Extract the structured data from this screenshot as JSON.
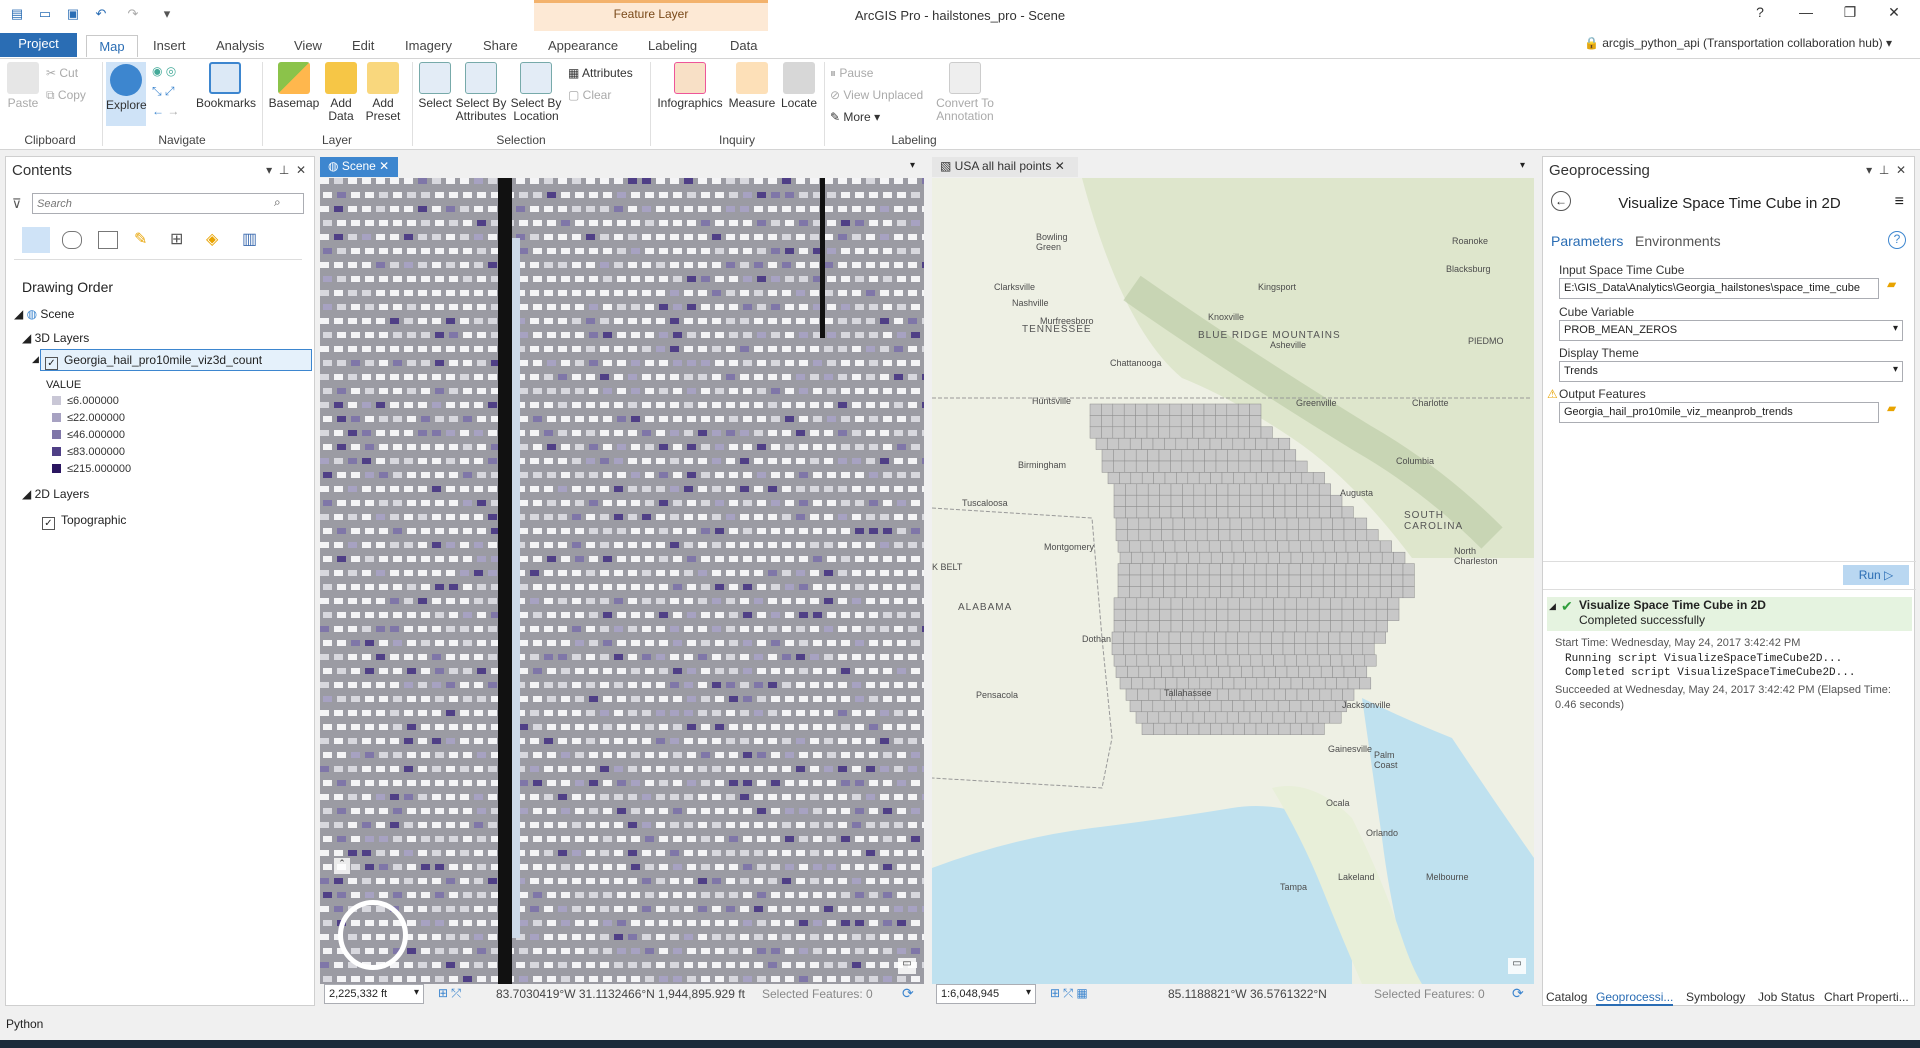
{
  "app": {
    "window_title": "ArcGIS Pro - hailstones_pro - Scene",
    "contextual_group": "Feature Layer",
    "user": "arcgis_python_api (Transportation collaboration hub)",
    "help": "?"
  },
  "tabs": [
    "Project",
    "Map",
    "Insert",
    "Analysis",
    "View",
    "Edit",
    "Imagery",
    "Share",
    "Appearance",
    "Labeling",
    "Data"
  ],
  "ribbon": {
    "clipboard": {
      "label": "Clipboard",
      "paste": "Paste",
      "cut": "Cut",
      "copy": "Copy"
    },
    "navigate": {
      "label": "Navigate",
      "explore": "Explore",
      "bookmarks": "Bookmarks"
    },
    "layer": {
      "label": "Layer",
      "basemap": "Basemap",
      "add_data": "Add\nData",
      "add_preset": "Add\nPreset"
    },
    "selection": {
      "label": "Selection",
      "select": "Select",
      "select_by_attributes": "Select By\nAttributes",
      "select_by_location": "Select By\nLocation",
      "attributes": "Attributes",
      "clear": "Clear"
    },
    "inquiry": {
      "label": "Inquiry",
      "infographics": "Infographics",
      "measure": "Measure",
      "locate": "Locate"
    },
    "labeling": {
      "label": "Labeling",
      "pause": "Pause",
      "view_unplaced": "View Unplaced",
      "more": "More",
      "convert": "Convert To\nAnnotation"
    }
  },
  "contents": {
    "title": "Contents",
    "search_placeholder": "Search",
    "drawing_order": "Drawing Order",
    "scene": "Scene",
    "layers_3d": "3D Layers",
    "layer_3d_name": "Georgia_hail_pro10mile_viz3d_count",
    "value_label": "VALUE",
    "legend": [
      {
        "label": "≤6.000000",
        "color": "#c9c7d6"
      },
      {
        "label": "≤22.000000",
        "color": "#a7a2c2"
      },
      {
        "label": "≤46.000000",
        "color": "#7f76a8"
      },
      {
        "label": "≤83.000000",
        "color": "#4f3f86"
      },
      {
        "label": "≤215.000000",
        "color": "#2a1560"
      }
    ],
    "layers_2d": "2D Layers",
    "layer_2d_name": "Topographic"
  },
  "views": {
    "scene_tab": "Scene",
    "map_tab": "USA all hail points"
  },
  "scene_status": {
    "scale": "2,225,332 ft",
    "coords": "83.7030419°W 31.1132466°N  1,944,895.929 ft",
    "selected": "Selected Features: 0"
  },
  "map_status": {
    "scale": "1:6,048,945",
    "coords": "85.1188821°W 36.5761322°N",
    "selected": "Selected Features: 0"
  },
  "map_labels": [
    {
      "t": "TENNESSEE",
      "big": true
    },
    {
      "t": "ALABAMA",
      "big": true
    },
    {
      "t": "SOUTH\nCAROLINA",
      "big": true
    },
    {
      "t": "BLUE RIDGE MOUNTAINS",
      "big": true
    },
    {
      "t": "Nashville"
    },
    {
      "t": "Murfreesboro"
    },
    {
      "t": "Knoxville"
    },
    {
      "t": "Chattanooga"
    },
    {
      "t": "Huntsville"
    },
    {
      "t": "Birmingham"
    },
    {
      "t": "Tuscaloosa"
    },
    {
      "t": "Montgomery"
    },
    {
      "t": "Dothan"
    },
    {
      "t": "Pensacola"
    },
    {
      "t": "Tallahassee"
    },
    {
      "t": "Jacksonville"
    },
    {
      "t": "Gainesville"
    },
    {
      "t": "Augusta"
    },
    {
      "t": "Columbia"
    },
    {
      "t": "Greenville"
    },
    {
      "t": "Asheville"
    },
    {
      "t": "Charlotte"
    },
    {
      "t": "Kingsport"
    },
    {
      "t": "Clarksville"
    },
    {
      "t": "Bowling\nGreen"
    },
    {
      "t": "Ocala"
    },
    {
      "t": "Orlando"
    },
    {
      "t": "Lakeland"
    },
    {
      "t": "Tampa"
    },
    {
      "t": "Palm\nCoast"
    },
    {
      "t": "Melbourne"
    },
    {
      "t": "North\nCharleston"
    },
    {
      "t": "Roanoke"
    },
    {
      "t": "Blacksburg"
    },
    {
      "t": "K BELT"
    },
    {
      "t": "PIEDMO"
    }
  ],
  "geoprocessing": {
    "title": "Geoprocessing",
    "tool": "Visualize Space Time Cube in 2D",
    "tab_parameters": "Parameters",
    "tab_environments": "Environments",
    "input_cube_label": "Input Space Time Cube",
    "input_cube_value": "E:\\GIS_Data\\Analytics\\Georgia_hailstones\\space_time_cube",
    "cube_var_label": "Cube Variable",
    "cube_var_value": "PROB_MEAN_ZEROS",
    "theme_label": "Display Theme",
    "theme_value": "Trends",
    "output_label": "Output Features",
    "output_value": "Georgia_hail_pro10mile_viz_meanprob_trends",
    "run": "Run",
    "msg_title": "Visualize Space Time Cube in 2D",
    "msg_status": "Completed successfully",
    "msg_start": "Start Time: Wednesday, May 24, 2017 3:42:42 PM",
    "msg_line1": "Running script VisualizeSpaceTimeCube2D...",
    "msg_line2": "Completed script VisualizeSpaceTimeCube2D...",
    "msg_end": "Succeeded at Wednesday, May 24, 2017 3:42:42 PM (Elapsed Time: 0.46 seconds)"
  },
  "bottom_tabs": [
    "Catalog",
    "Geoprocessi...",
    "Symbology",
    "Job Status",
    "Chart Properti..."
  ],
  "python_label": "Python"
}
